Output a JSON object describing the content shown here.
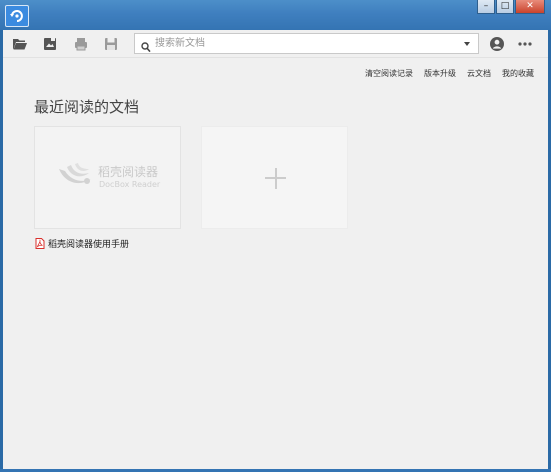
{
  "titlebar": {
    "logo_icon": "app-logo-icon",
    "controls": {
      "minimize": "–",
      "maximize": "□",
      "close": "✕"
    }
  },
  "toolbar": {
    "icons": [
      "open-folder-icon",
      "save-image-icon",
      "print-icon",
      "save-disk-icon",
      "user-icon",
      "more-icon"
    ],
    "search": {
      "placeholder": "搜索新文档",
      "value": ""
    }
  },
  "links": {
    "clear_history": "清空阅读记录",
    "upgrade": "版本升级",
    "cloud_docs": "云文档",
    "favorites": "我的收藏"
  },
  "main": {
    "section_title": "最近阅读的文档",
    "recent_doc": {
      "brand_cn": "稻壳阅读器",
      "brand_en": "DocBox Reader",
      "file_name": "稻壳阅读器使用手册",
      "file_icon": "pdf-icon"
    },
    "add_card_icon": "plus-icon"
  },
  "colors": {
    "title_bar": "#3f7fbf",
    "logo_blue": "#3b8be0",
    "background": "#f0f0f0",
    "pdf_red": "#d9302c"
  }
}
